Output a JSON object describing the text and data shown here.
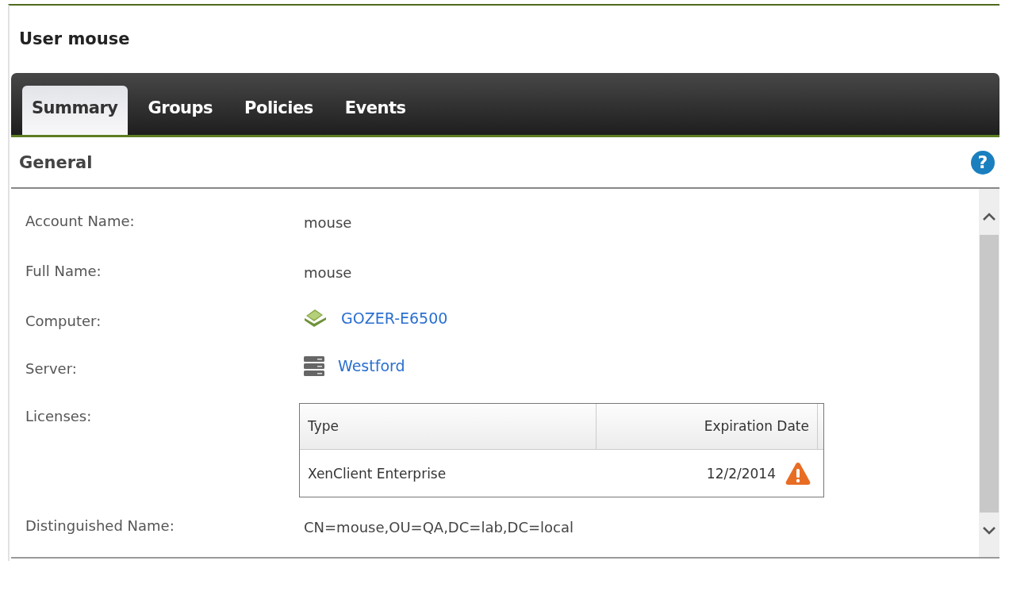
{
  "title": "User mouse",
  "tabs": [
    {
      "label": "Summary",
      "selected": true
    },
    {
      "label": "Groups",
      "selected": false
    },
    {
      "label": "Policies",
      "selected": false
    },
    {
      "label": "Events",
      "selected": false
    }
  ],
  "section": {
    "title": "General",
    "help": "?"
  },
  "fields": [
    {
      "kind": "text",
      "label": "Account Name:",
      "value": "mouse"
    },
    {
      "kind": "text",
      "label": "Full Name:",
      "value": "mouse"
    },
    {
      "kind": "computer",
      "label": "Computer:",
      "value": "GOZER-E6500"
    },
    {
      "kind": "server",
      "label": "Server:",
      "value": "Westford"
    },
    {
      "kind": "table",
      "label": "Licenses:",
      "columns": [
        "Type",
        "Expiration Date"
      ],
      "rows": [
        {
          "type": "XenClient Enterprise",
          "expiration": "12/2/2014",
          "warning": true
        }
      ]
    },
    {
      "kind": "text",
      "label": "Distinguished Name:",
      "value": "CN=mouse,OU=QA,DC=lab,DC=local"
    }
  ]
}
